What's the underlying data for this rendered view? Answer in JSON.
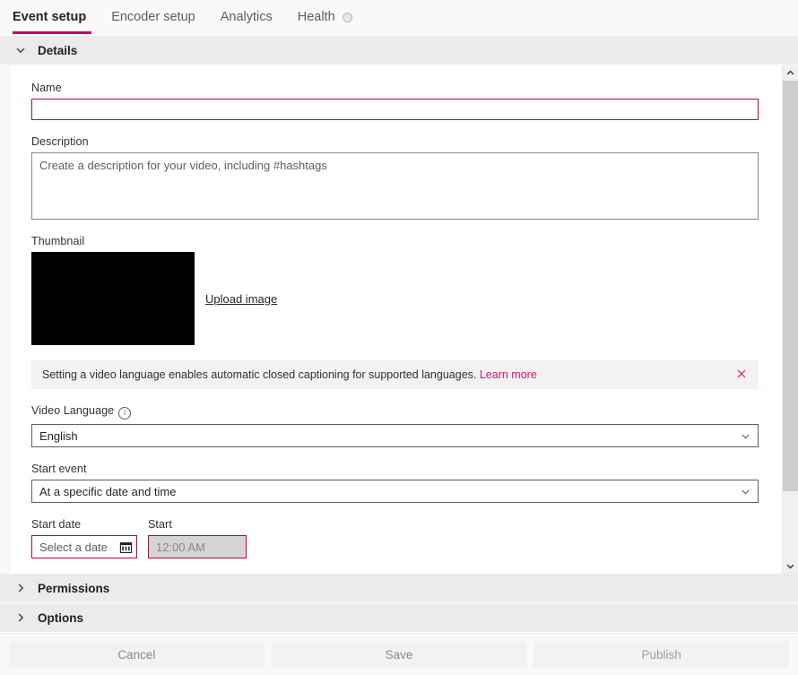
{
  "tabs": [
    {
      "label": "Event setup",
      "active": true,
      "indicator": null
    },
    {
      "label": "Encoder setup",
      "active": false,
      "indicator": null
    },
    {
      "label": "Analytics",
      "active": false,
      "indicator": null
    },
    {
      "label": "Health",
      "active": false,
      "indicator": "status-dot"
    }
  ],
  "sections": {
    "details": {
      "label": "Details",
      "expanded": true,
      "icon": "chevron-down-icon"
    },
    "permissions": {
      "label": "Permissions",
      "expanded": false,
      "icon": "chevron-right-icon"
    },
    "options": {
      "label": "Options",
      "expanded": false,
      "icon": "chevron-right-icon"
    }
  },
  "form": {
    "name": {
      "label": "Name",
      "value": "",
      "placeholder": "",
      "state": "invalid"
    },
    "description": {
      "label": "Description",
      "value": "",
      "placeholder": "Create a description for your video, including #hashtags"
    },
    "thumbnail": {
      "label": "Thumbnail",
      "upload_label": "Upload image",
      "image_color": "#000000"
    },
    "banner": {
      "text": "Setting a video language enables automatic closed captioning for supported languages.",
      "link_label": "Learn more",
      "close_icon": "close-icon"
    },
    "video_language": {
      "label": "Video Language",
      "info_icon": "info-icon",
      "value": "English",
      "options": [
        "English"
      ]
    },
    "start_event": {
      "label": "Start event",
      "value": "At a specific date and time",
      "options": [
        "At a specific date and time"
      ]
    },
    "start_date": {
      "label": "Start date",
      "value": "",
      "placeholder": "Select a date",
      "icon": "calendar-icon",
      "state": "invalid"
    },
    "start_time": {
      "label": "Start",
      "value": "12:00 AM",
      "disabled": true,
      "state": "invalid"
    }
  },
  "footer": {
    "cancel_label": "Cancel",
    "save_label": "Save",
    "publish_label": "Publish"
  },
  "scrollbar": {
    "up_icon": "chevron-up-icon",
    "down_icon": "chevron-down-icon"
  },
  "colors": {
    "accent": "#bf0061",
    "link": "#d6176f",
    "error": "#c4003c",
    "section_bg": "#eceaea"
  }
}
